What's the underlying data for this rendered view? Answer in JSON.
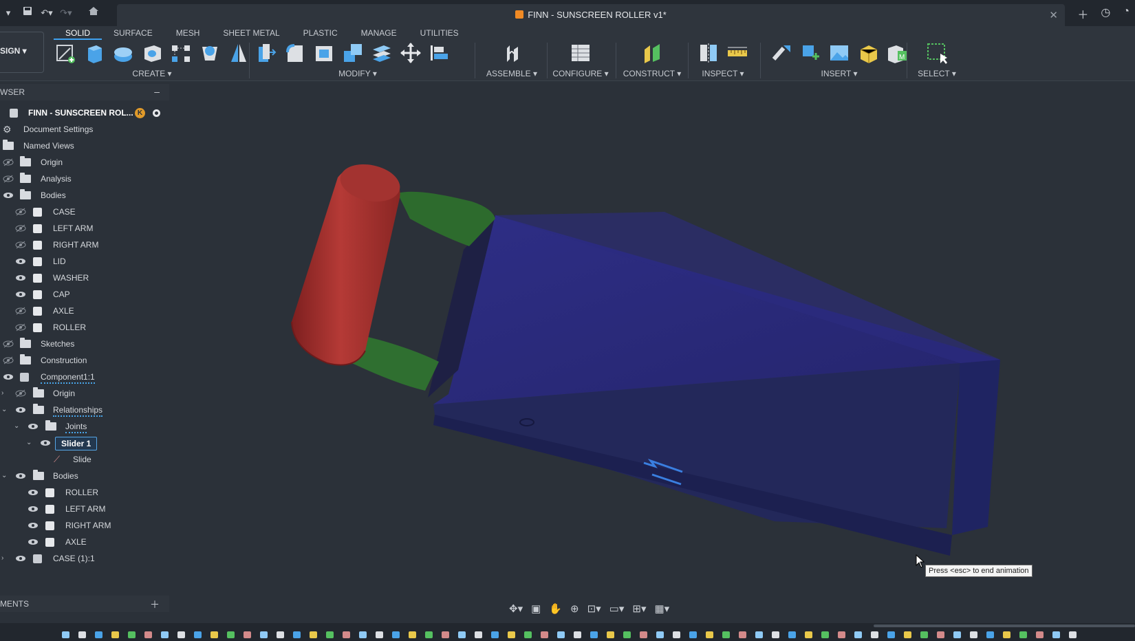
{
  "window": {
    "title": "FINN - SUNSCREEN ROLLER v1*"
  },
  "toolbar": {
    "workspace": "SIGN",
    "tabs": [
      "SOLID",
      "SURFACE",
      "MESH",
      "SHEET METAL",
      "PLASTIC",
      "MANAGE",
      "UTILITIES"
    ],
    "active_tab": "SOLID",
    "groups": {
      "create": "CREATE",
      "modify": "MODIFY",
      "assemble": "ASSEMBLE",
      "configure": "CONFIGURE",
      "construct": "CONSTRUCT",
      "inspect": "INSPECT",
      "insert": "INSERT",
      "select": "SELECT"
    }
  },
  "browser": {
    "header": "WSER",
    "root": "FINN - SUNSCREEN ROL...",
    "items": {
      "document_settings": "Document Settings",
      "named_views": "Named Views",
      "origin": "Origin",
      "analysis": "Analysis",
      "bodies": "Bodies",
      "case": "CASE",
      "left_arm": "LEFT ARM",
      "right_arm": "RIGHT ARM",
      "lid": "LID",
      "washer": "WASHER",
      "cap": "CAP",
      "axle": "AXLE",
      "roller": "ROLLER",
      "sketches": "Sketches",
      "construction": "Construction",
      "component": "Component1:1",
      "c_origin": "Origin",
      "relationships": "Relationships",
      "joints": "Joints",
      "slider": "Slider 1",
      "slide": "Slide",
      "c_bodies": "Bodies",
      "c_roller": "ROLLER",
      "c_left_arm": "LEFT ARM",
      "c_right_arm": "RIGHT ARM",
      "c_axle": "AXLE",
      "case_component": "CASE (1):1"
    }
  },
  "comments": {
    "header": "MENTS"
  },
  "tooltip": {
    "text": "Press <esc> to end animation"
  },
  "colors": {
    "roller": "#a8302e",
    "arms": "#2f6b2f",
    "case": "#2a2a78",
    "accent": "#3fa2f0"
  }
}
